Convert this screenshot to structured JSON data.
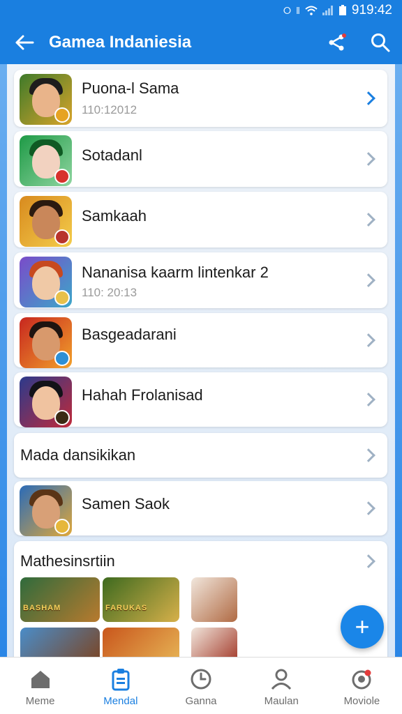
{
  "status_bar": {
    "time": "919:42",
    "icons": [
      "bluetooth-icon",
      "vibrate-icon",
      "wifi-icon",
      "signal-icon",
      "battery-icon"
    ]
  },
  "app_bar": {
    "title": "Gamea Indaniesia",
    "back_icon": "arrow-left-icon",
    "share_icon": "share-icon",
    "search_icon": "search-icon"
  },
  "list": {
    "items": [
      {
        "title": "Puona-l Sama",
        "subtitle": "110:12012",
        "icon": "game-icon-1",
        "chevron_active": true
      },
      {
        "title": "Sotadanl",
        "subtitle": "",
        "icon": "game-icon-2",
        "chevron_active": false
      },
      {
        "title": "Samkaah",
        "subtitle": "",
        "icon": "game-icon-3",
        "chevron_active": false
      },
      {
        "title": "Nananisa kaarm lintenkar 2",
        "subtitle": "110: 20:13",
        "icon": "game-icon-4",
        "chevron_active": false
      },
      {
        "title": "Basgeadarani",
        "subtitle": "",
        "icon": "game-icon-5",
        "chevron_active": false
      },
      {
        "title": "Hahah Frolanisad",
        "subtitle": "",
        "icon": "game-icon-6",
        "chevron_active": false
      }
    ],
    "section_row": {
      "title": "Mada dansikikan"
    },
    "single_item": {
      "title": "Samen Saok",
      "icon": "game-icon-7"
    },
    "gallery": {
      "title": "Mathesinsrtiin",
      "thumb_captions": [
        "BASHAM",
        "FARUKAS"
      ]
    }
  },
  "fab": {
    "label": "+",
    "icon": "plus-icon"
  },
  "bottom_nav": {
    "items": [
      {
        "label": "Meme",
        "icon": "home-icon",
        "active": false
      },
      {
        "label": "Mendal",
        "icon": "clipboard-icon",
        "active": true
      },
      {
        "label": "Ganna",
        "icon": "clock-icon",
        "active": false
      },
      {
        "label": "Maulan",
        "icon": "person-icon",
        "active": false
      },
      {
        "label": "Moviole",
        "icon": "profile-alert-icon",
        "active": false
      }
    ]
  },
  "colors": {
    "primary": "#1a7fe0",
    "background": "#e9eff7",
    "card": "#ffffff",
    "text": "#1b1b1b",
    "muted": "#9a9a9a"
  }
}
